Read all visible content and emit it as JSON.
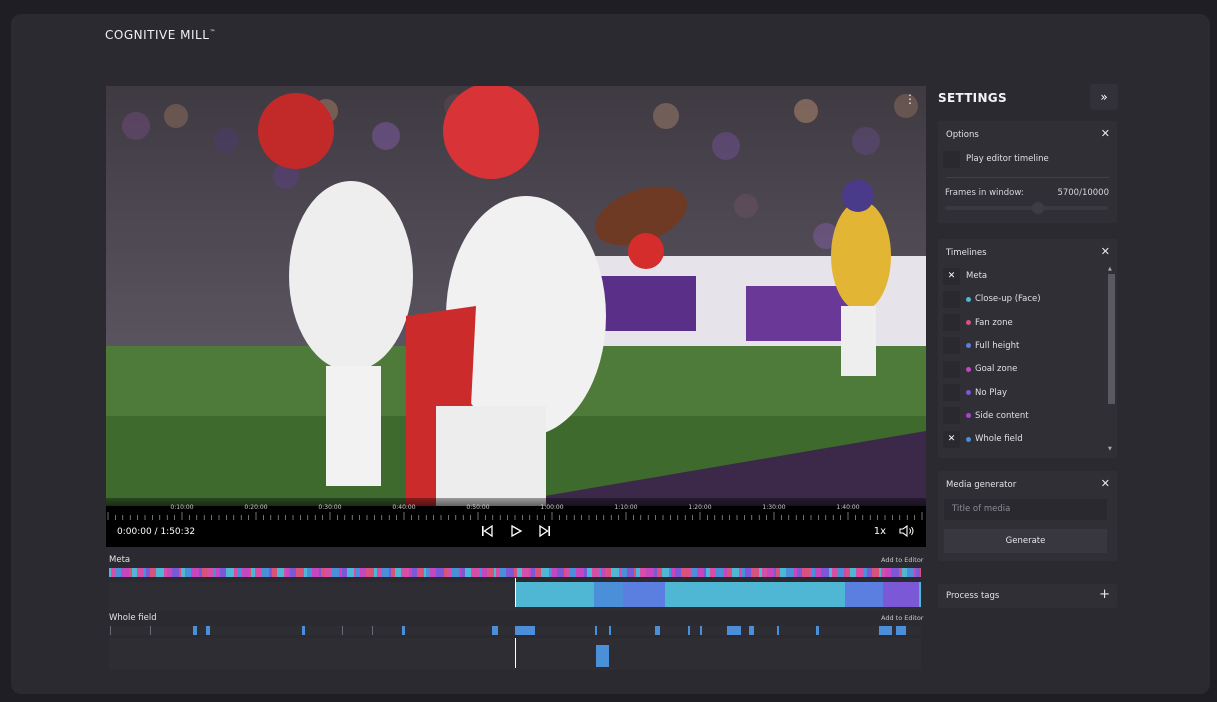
{
  "app": {
    "logo": "COGNITIVE MILL",
    "logo_mark": "™"
  },
  "player": {
    "time_display": "0:00:00 / 1:50:32",
    "speed": "1x",
    "ruler_labels": [
      "0:10:00",
      "0:20:00",
      "0:30:00",
      "0:40:00",
      "0:50:00",
      "1:00:00",
      "1:10:00",
      "1:20:00",
      "1:30:00",
      "1:40:00"
    ]
  },
  "timelines_view": [
    {
      "label": "Meta",
      "add_label": "Add to Editor"
    },
    {
      "label": "Whole field",
      "add_label": "Add to Editor"
    }
  ],
  "settings": {
    "title": "SETTINGS",
    "options": {
      "title": "Options",
      "play_editor_label": "Play editor timeline",
      "frames_label": "Frames in window:",
      "frames_value": "5700/10000",
      "frames_fraction": 0.57
    },
    "timelines": {
      "title": "Timelines",
      "items": [
        {
          "label": "Meta",
          "checked": true,
          "color": ""
        },
        {
          "label": "Close-up (Face)",
          "checked": false,
          "color": "#4fb6d3"
        },
        {
          "label": "Fan zone",
          "checked": false,
          "color": "#d8537c"
        },
        {
          "label": "Full height",
          "checked": false,
          "color": "#5b7fe0"
        },
        {
          "label": "Goal zone",
          "checked": false,
          "color": "#c447bf"
        },
        {
          "label": "No Play",
          "checked": false,
          "color": "#7a58d6"
        },
        {
          "label": "Side content",
          "checked": false,
          "color": "#a845cf"
        },
        {
          "label": "Whole field",
          "checked": true,
          "color": "#4b8fd9"
        }
      ]
    },
    "media_generator": {
      "title": "Media generator",
      "placeholder": "Title of media",
      "generate_label": "Generate"
    },
    "process_tags": {
      "title": "Process tags"
    }
  },
  "colors": {
    "accent_cyan": "#4fb6d3",
    "accent_blue": "#4b8fd9",
    "accent_pink": "#d54fa6",
    "accent_purple": "#7a58d6"
  }
}
